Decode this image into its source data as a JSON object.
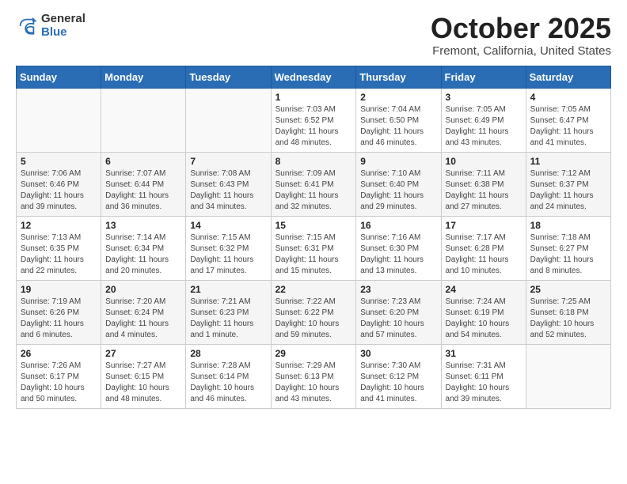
{
  "logo": {
    "general": "General",
    "blue": "Blue"
  },
  "header": {
    "month": "October 2025",
    "location": "Fremont, California, United States"
  },
  "weekdays": [
    "Sunday",
    "Monday",
    "Tuesday",
    "Wednesday",
    "Thursday",
    "Friday",
    "Saturday"
  ],
  "weeks": [
    [
      {
        "day": "",
        "info": ""
      },
      {
        "day": "",
        "info": ""
      },
      {
        "day": "",
        "info": ""
      },
      {
        "day": "1",
        "info": "Sunrise: 7:03 AM\nSunset: 6:52 PM\nDaylight: 11 hours\nand 48 minutes."
      },
      {
        "day": "2",
        "info": "Sunrise: 7:04 AM\nSunset: 6:50 PM\nDaylight: 11 hours\nand 46 minutes."
      },
      {
        "day": "3",
        "info": "Sunrise: 7:05 AM\nSunset: 6:49 PM\nDaylight: 11 hours\nand 43 minutes."
      },
      {
        "day": "4",
        "info": "Sunrise: 7:05 AM\nSunset: 6:47 PM\nDaylight: 11 hours\nand 41 minutes."
      }
    ],
    [
      {
        "day": "5",
        "info": "Sunrise: 7:06 AM\nSunset: 6:46 PM\nDaylight: 11 hours\nand 39 minutes."
      },
      {
        "day": "6",
        "info": "Sunrise: 7:07 AM\nSunset: 6:44 PM\nDaylight: 11 hours\nand 36 minutes."
      },
      {
        "day": "7",
        "info": "Sunrise: 7:08 AM\nSunset: 6:43 PM\nDaylight: 11 hours\nand 34 minutes."
      },
      {
        "day": "8",
        "info": "Sunrise: 7:09 AM\nSunset: 6:41 PM\nDaylight: 11 hours\nand 32 minutes."
      },
      {
        "day": "9",
        "info": "Sunrise: 7:10 AM\nSunset: 6:40 PM\nDaylight: 11 hours\nand 29 minutes."
      },
      {
        "day": "10",
        "info": "Sunrise: 7:11 AM\nSunset: 6:38 PM\nDaylight: 11 hours\nand 27 minutes."
      },
      {
        "day": "11",
        "info": "Sunrise: 7:12 AM\nSunset: 6:37 PM\nDaylight: 11 hours\nand 24 minutes."
      }
    ],
    [
      {
        "day": "12",
        "info": "Sunrise: 7:13 AM\nSunset: 6:35 PM\nDaylight: 11 hours\nand 22 minutes."
      },
      {
        "day": "13",
        "info": "Sunrise: 7:14 AM\nSunset: 6:34 PM\nDaylight: 11 hours\nand 20 minutes."
      },
      {
        "day": "14",
        "info": "Sunrise: 7:15 AM\nSunset: 6:32 PM\nDaylight: 11 hours\nand 17 minutes."
      },
      {
        "day": "15",
        "info": "Sunrise: 7:15 AM\nSunset: 6:31 PM\nDaylight: 11 hours\nand 15 minutes."
      },
      {
        "day": "16",
        "info": "Sunrise: 7:16 AM\nSunset: 6:30 PM\nDaylight: 11 hours\nand 13 minutes."
      },
      {
        "day": "17",
        "info": "Sunrise: 7:17 AM\nSunset: 6:28 PM\nDaylight: 11 hours\nand 10 minutes."
      },
      {
        "day": "18",
        "info": "Sunrise: 7:18 AM\nSunset: 6:27 PM\nDaylight: 11 hours\nand 8 minutes."
      }
    ],
    [
      {
        "day": "19",
        "info": "Sunrise: 7:19 AM\nSunset: 6:26 PM\nDaylight: 11 hours\nand 6 minutes."
      },
      {
        "day": "20",
        "info": "Sunrise: 7:20 AM\nSunset: 6:24 PM\nDaylight: 11 hours\nand 4 minutes."
      },
      {
        "day": "21",
        "info": "Sunrise: 7:21 AM\nSunset: 6:23 PM\nDaylight: 11 hours\nand 1 minute."
      },
      {
        "day": "22",
        "info": "Sunrise: 7:22 AM\nSunset: 6:22 PM\nDaylight: 10 hours\nand 59 minutes."
      },
      {
        "day": "23",
        "info": "Sunrise: 7:23 AM\nSunset: 6:20 PM\nDaylight: 10 hours\nand 57 minutes."
      },
      {
        "day": "24",
        "info": "Sunrise: 7:24 AM\nSunset: 6:19 PM\nDaylight: 10 hours\nand 54 minutes."
      },
      {
        "day": "25",
        "info": "Sunrise: 7:25 AM\nSunset: 6:18 PM\nDaylight: 10 hours\nand 52 minutes."
      }
    ],
    [
      {
        "day": "26",
        "info": "Sunrise: 7:26 AM\nSunset: 6:17 PM\nDaylight: 10 hours\nand 50 minutes."
      },
      {
        "day": "27",
        "info": "Sunrise: 7:27 AM\nSunset: 6:15 PM\nDaylight: 10 hours\nand 48 minutes."
      },
      {
        "day": "28",
        "info": "Sunrise: 7:28 AM\nSunset: 6:14 PM\nDaylight: 10 hours\nand 46 minutes."
      },
      {
        "day": "29",
        "info": "Sunrise: 7:29 AM\nSunset: 6:13 PM\nDaylight: 10 hours\nand 43 minutes."
      },
      {
        "day": "30",
        "info": "Sunrise: 7:30 AM\nSunset: 6:12 PM\nDaylight: 10 hours\nand 41 minutes."
      },
      {
        "day": "31",
        "info": "Sunrise: 7:31 AM\nSunset: 6:11 PM\nDaylight: 10 hours\nand 39 minutes."
      },
      {
        "day": "",
        "info": ""
      }
    ]
  ]
}
